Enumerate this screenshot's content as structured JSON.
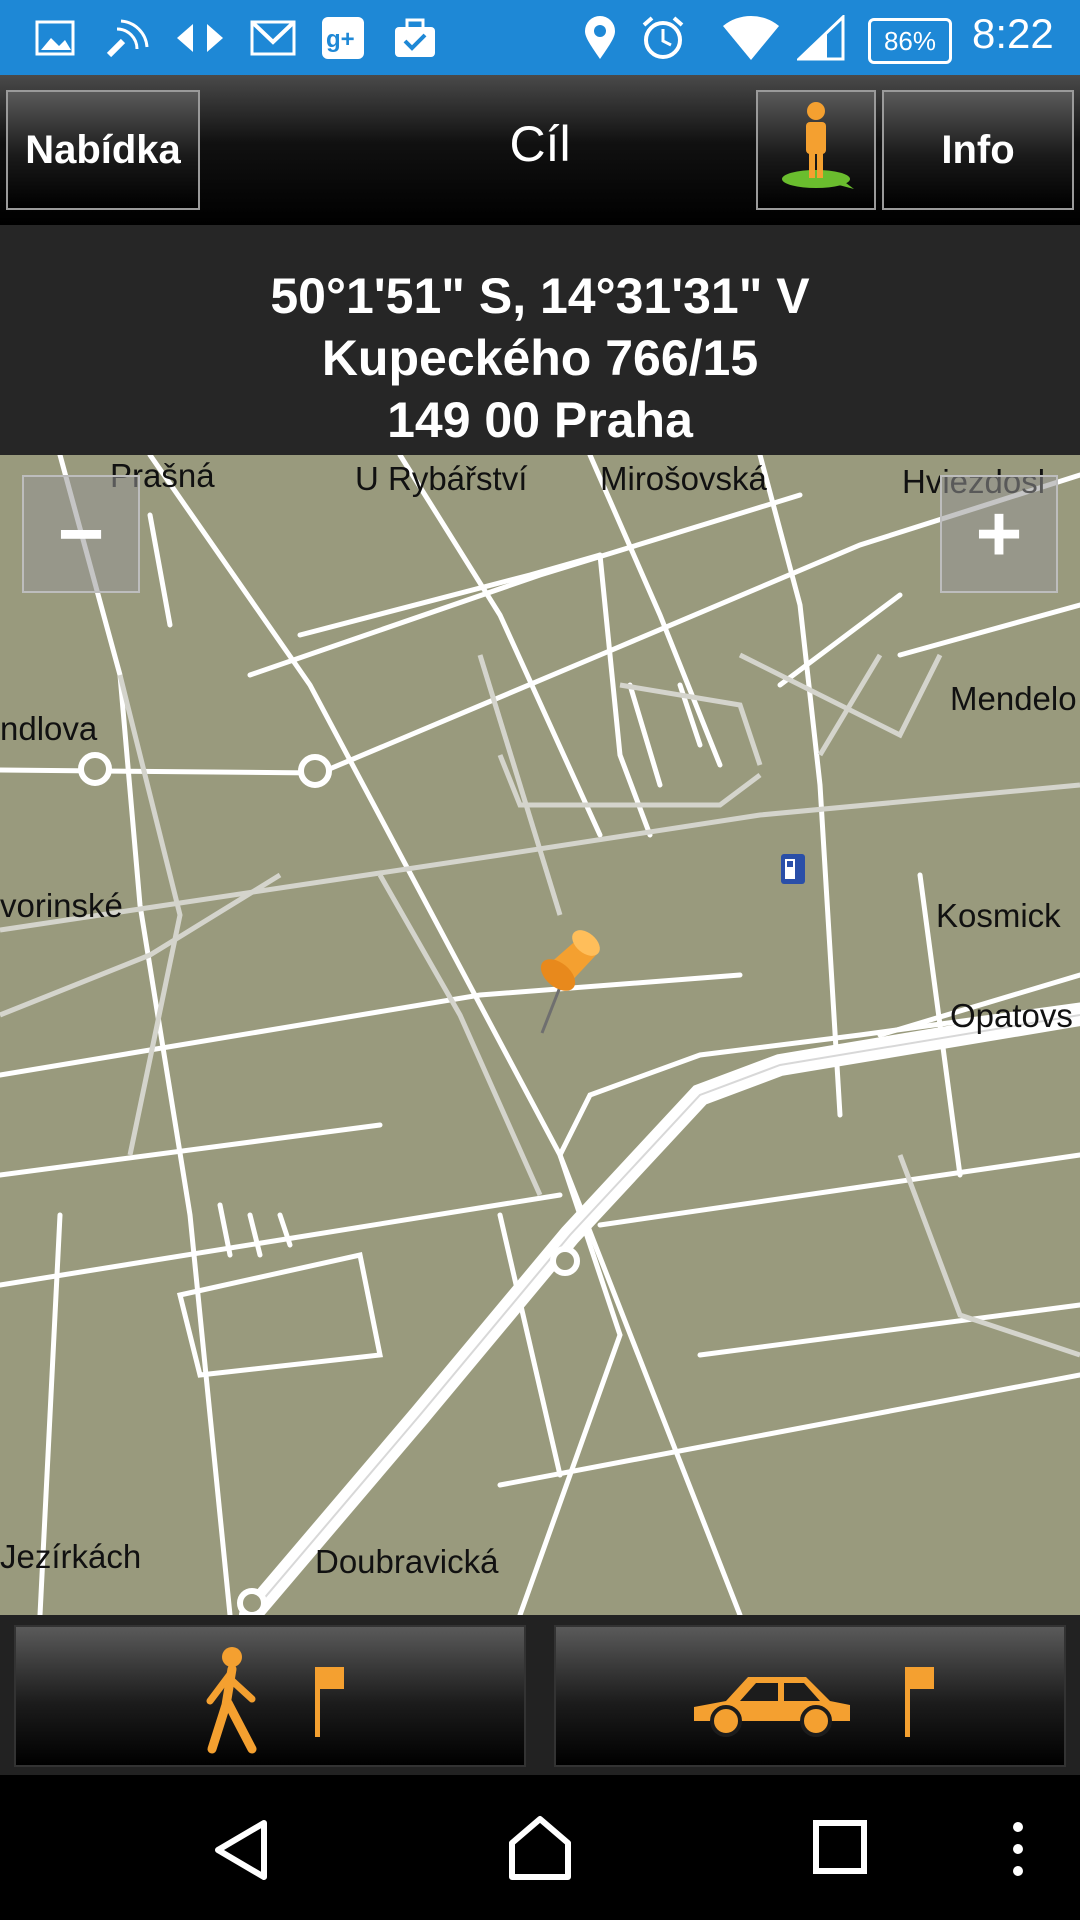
{
  "statusbar": {
    "battery": "86%",
    "time": "8:22",
    "icons": [
      "gallery-icon",
      "satellite-icon",
      "data-transfer-icon",
      "gmail-icon",
      "google-plus-icon",
      "briefcase-icon",
      "location-icon",
      "alarm-icon",
      "wifi-icon",
      "signal-icon",
      "battery-icon"
    ]
  },
  "header": {
    "menu_label": "Nabídka",
    "title": "Cíl",
    "info_label": "Info"
  },
  "destination": {
    "coordinates": "50°1'51\" S, 14°31'31\" V",
    "street": "Kupeckého 766/15",
    "city": "149 00 Praha"
  },
  "map": {
    "zoom_out": "−",
    "zoom_in": "+",
    "streets": [
      "Prašná",
      "U Rybářství",
      "Mirošovská",
      "Hviezdosl",
      "Mendelo",
      "ndlova",
      "vorinské",
      "Kosmick",
      "Opatovs",
      "Jezírkách",
      "Doubravická"
    ],
    "colors": {
      "land": "#999a7d",
      "road": "#ffffff",
      "minor_road": "#d9d9d9",
      "pin": "#f4a030"
    }
  },
  "bottom": {
    "walk_button": "walk-to-destination",
    "car_button": "drive-to-destination",
    "accent": "#f4a030"
  }
}
